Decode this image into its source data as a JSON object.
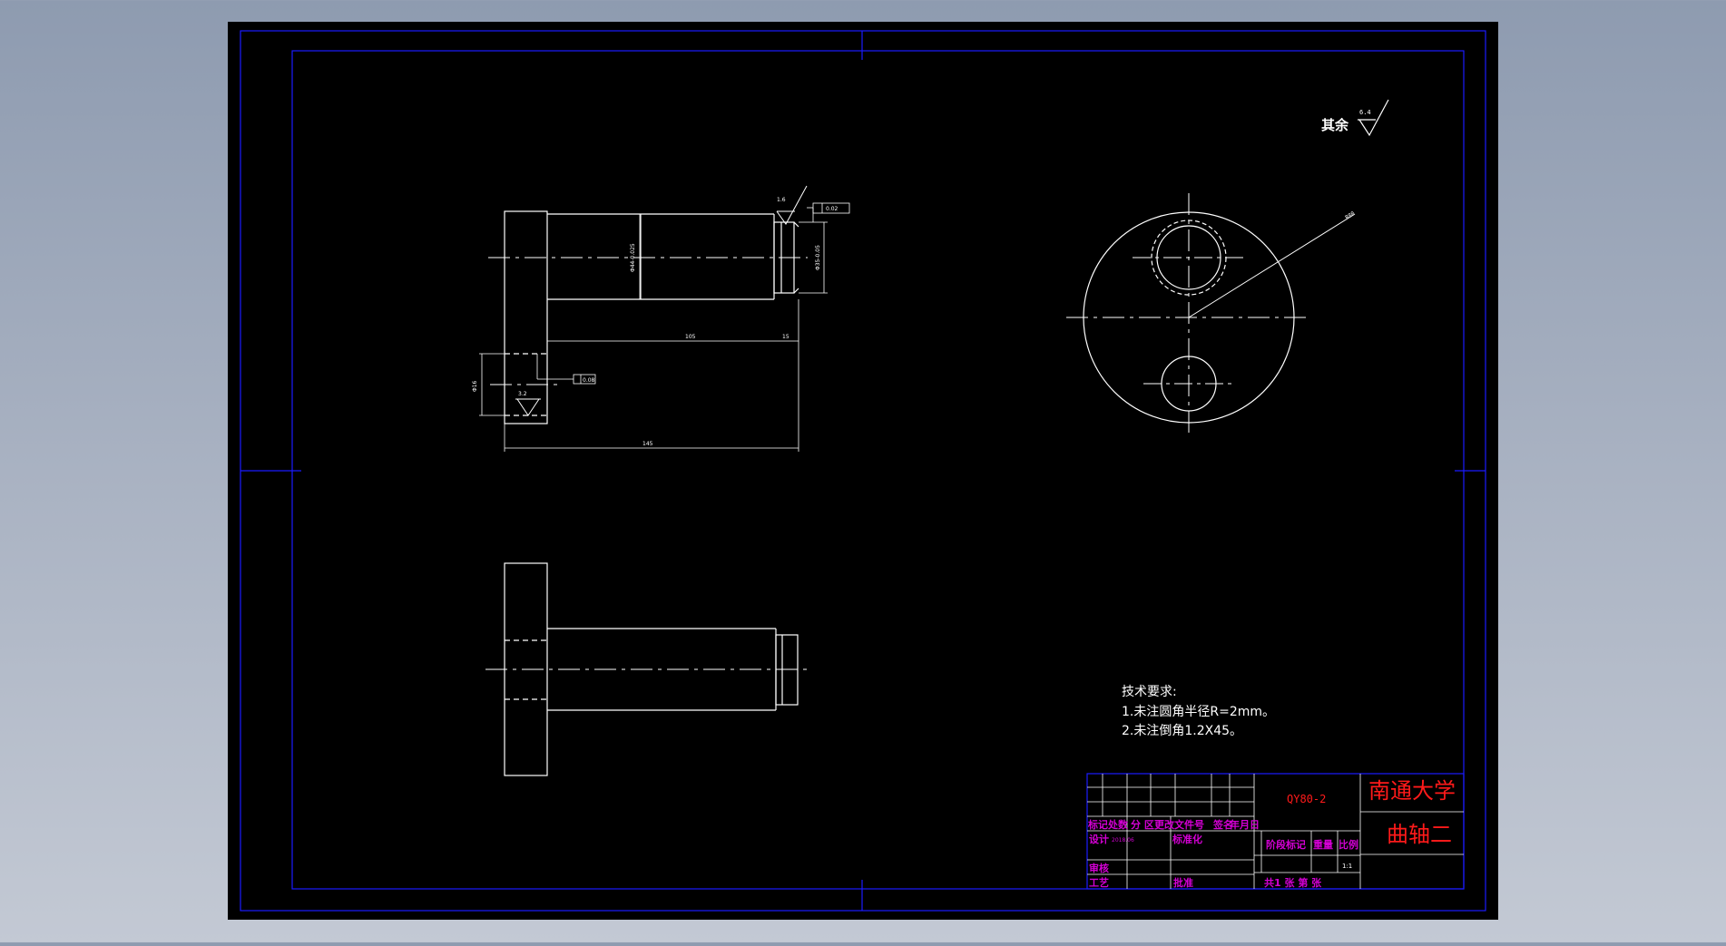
{
  "colors": {
    "canvas": "#000000",
    "frame": "#1a1aff",
    "geometry": "#ffffff",
    "title_text": "#ff1a1a",
    "table_text": "#d400d4",
    "backdrop": "#a9b2c2"
  },
  "drawing": {
    "roughness_note": {
      "prefix": "其余",
      "value": "6.4"
    },
    "tech_requirements": {
      "heading": "技术要求:",
      "items": [
        "1.未注圆角半径R=2mm。",
        "2.未注倒角1.2X45。"
      ]
    },
    "dimensions": {
      "shaft_diameter": "Φ44-0.025",
      "end_diameter": "Φ35-0.05",
      "shaft_length": "105",
      "end_length": "15",
      "total_length": "145",
      "hole_diameter": "Φ16",
      "roughness_top": "1.6",
      "roughness_hole": "3.2",
      "tol_top": "0.02",
      "tol_hole": "0.08",
      "radius_label": "R80"
    }
  },
  "title_block": {
    "drawing_number": "QY80-2",
    "university": "南通大学",
    "part_name": "曲轴二",
    "header_row": [
      "标记",
      "处数",
      "分 区",
      "更改文件号",
      "签名",
      "年月日"
    ],
    "designer_label": "设计",
    "designer_sign": "2018.06",
    "standard_label": "标准化",
    "stage_label": "阶段标记",
    "weight_label": "重量",
    "scale_label": "比例",
    "scale_value": "1:1",
    "review_label": "审核",
    "process_label": "工艺",
    "approve_label": "批准",
    "sheet_info": "共1 张 第   张"
  }
}
